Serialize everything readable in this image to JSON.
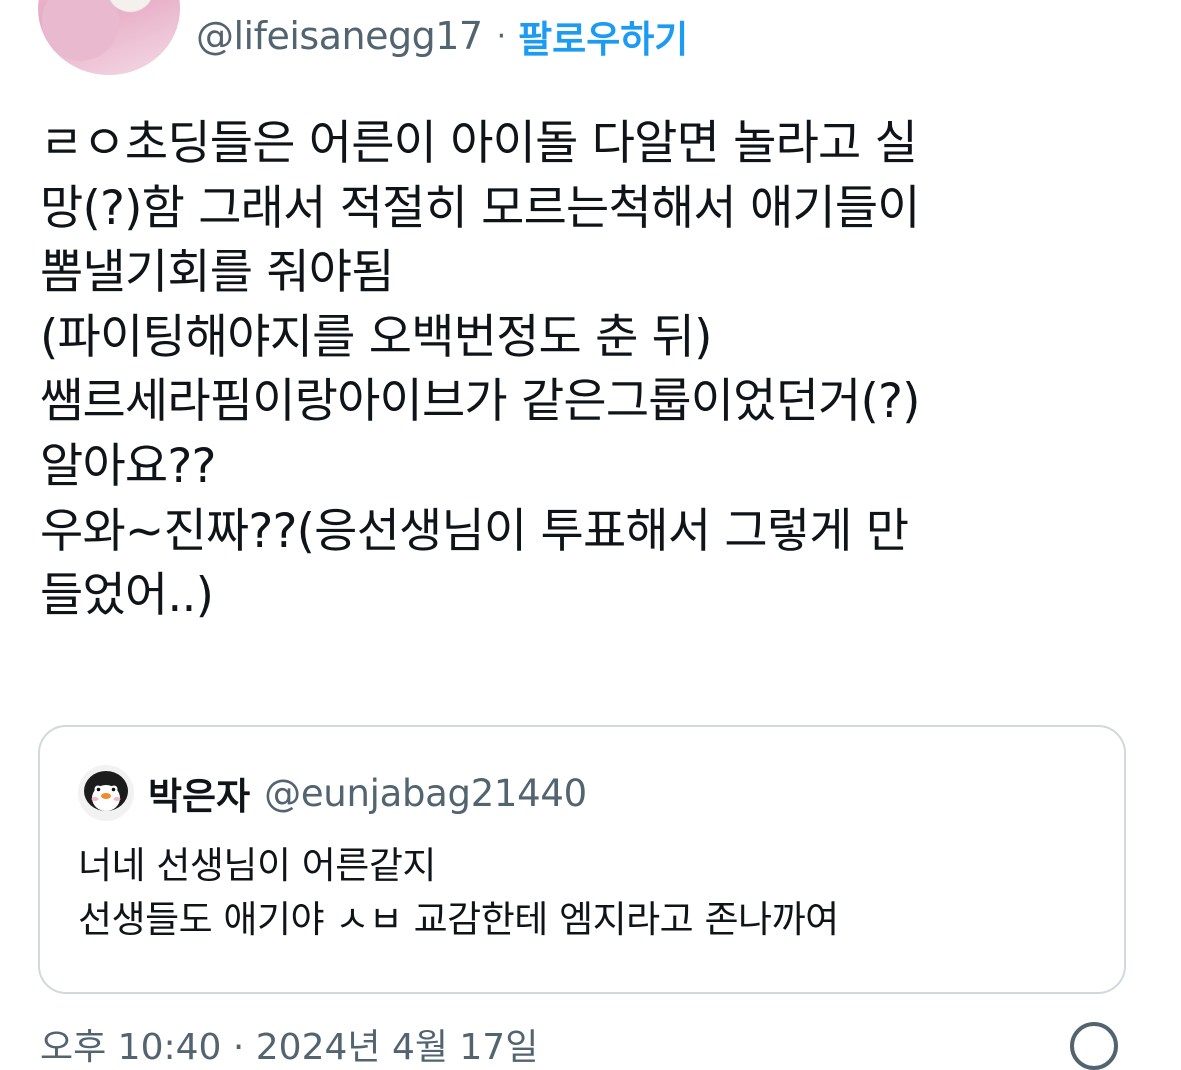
{
  "author": {
    "handle": "@lifeisanegg17",
    "separator": "·",
    "follow_label": "팔로우하기"
  },
  "tweet": {
    "lines": [
      "ㄹㅇ초딩들은 어른이 아이돌 다알면 놀라고 실",
      "망(?)함 그래서 적절히 모르는척해서 애기들이",
      "뽐낼기회를 줘야됨",
      "(파이팅해야지를 오백번정도 춘 뒤)",
      "쌤르세라핌이랑아이브가 같은그룹이었던거(?)",
      "알아요??",
      "우와~진짜??(응선생님이 투표해서 그렇게 만",
      "들었어..)"
    ]
  },
  "quote": {
    "name": "박은자",
    "handle": "@eunjabag21440",
    "lines": [
      "너네 선생님이 어른같지",
      "선생들도 애기야 ㅅㅂ 교감한테 엠지라고 존나까여"
    ],
    "avatar_icon": "penguin-icon"
  },
  "timestamp": "오후 10:40 · 2024년 4월 17일",
  "colors": {
    "accent": "#1d9bf0",
    "secondary_text": "#536471",
    "primary_text": "#0f1419",
    "border": "#cfd9de"
  }
}
